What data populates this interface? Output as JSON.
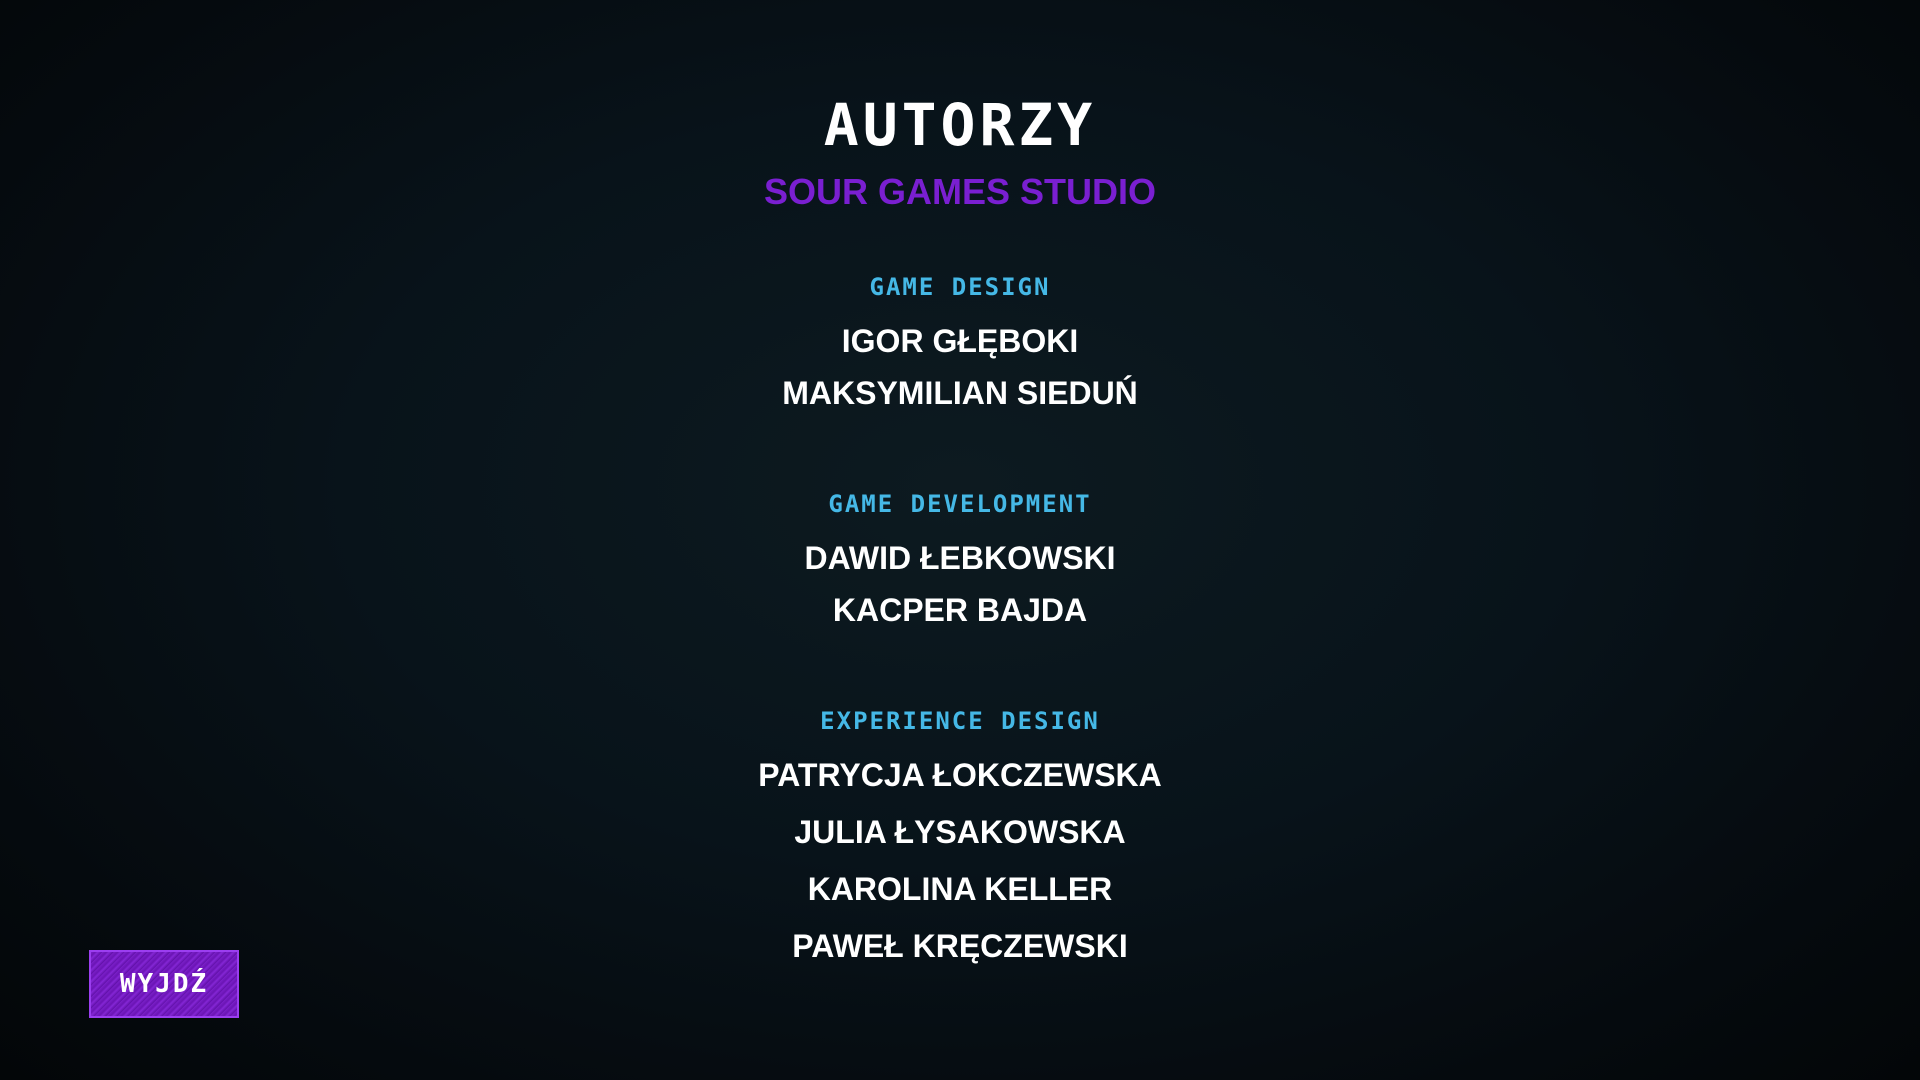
{
  "header": {
    "title": "AUTORZY",
    "studio": "SOUR GAMES STUDIO"
  },
  "sections": [
    {
      "heading": "GAME DESIGN",
      "names": [
        "IGOR GŁĘBOKI",
        "MAKSYMILIAN SIEDUŃ"
      ]
    },
    {
      "heading": "GAME DEVELOPMENT",
      "names": [
        "DAWID ŁEBKOWSKI",
        "KACPER BAJDA"
      ]
    },
    {
      "heading": "EXPERIENCE DESIGN",
      "names": [
        "PATRYCJA ŁOKCZEWSKA",
        "JULIA ŁYSAKOWSKA",
        "KAROLINA KELLER",
        "PAWEŁ KRĘCZEWSKI"
      ]
    }
  ],
  "exit_button": {
    "label": "WYJDŹ"
  },
  "colors": {
    "background": "#08131a",
    "title": "#ffffff",
    "studio": "#7a1fd1",
    "section_heading": "#45b8e6",
    "name": "#ffffff",
    "button_bg": "#7b20c9"
  }
}
